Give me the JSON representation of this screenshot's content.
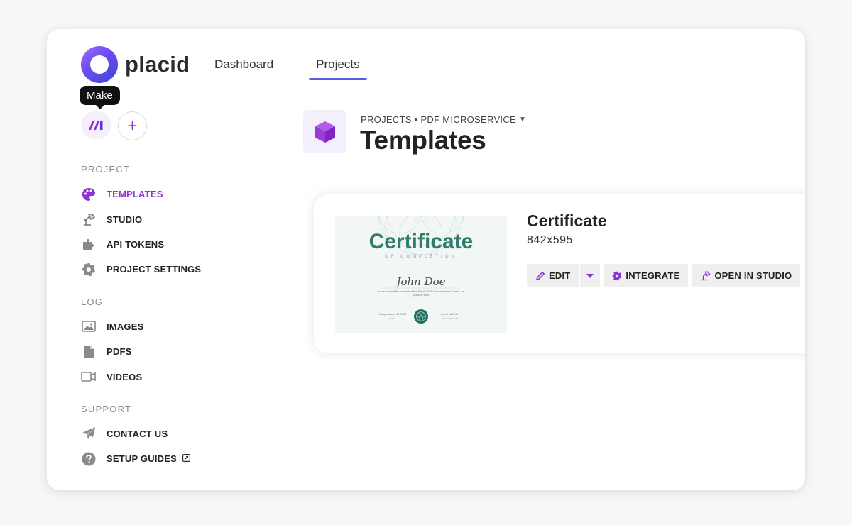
{
  "app": {
    "name": "placid"
  },
  "topnav": {
    "tabs": [
      {
        "label": "Dashboard",
        "active": false
      },
      {
        "label": "Projects",
        "active": true
      }
    ]
  },
  "workspace": {
    "tooltip": "Make",
    "add_label": "+"
  },
  "sidebar": {
    "sections": [
      {
        "title": "PROJECT",
        "items": [
          {
            "label": "TEMPLATES",
            "icon": "palette-icon",
            "active": true
          },
          {
            "label": "STUDIO",
            "icon": "lamp-icon",
            "active": false
          },
          {
            "label": "API TOKENS",
            "icon": "puzzle-icon",
            "active": false
          },
          {
            "label": "PROJECT SETTINGS",
            "icon": "gear-icon",
            "active": false
          }
        ]
      },
      {
        "title": "LOG",
        "items": [
          {
            "label": "IMAGES",
            "icon": "image-icon"
          },
          {
            "label": "PDFS",
            "icon": "file-icon"
          },
          {
            "label": "VIDEOS",
            "icon": "video-icon"
          }
        ]
      },
      {
        "title": "SUPPORT",
        "items": [
          {
            "label": "CONTACT US",
            "icon": "paper-plane-icon"
          },
          {
            "label": "SETUP GUIDES",
            "icon": "question-circle-icon",
            "external": true
          }
        ]
      }
    ]
  },
  "header": {
    "breadcrumb": "PROJECTS • PDF MICROSERVICE",
    "title": "Templates"
  },
  "template_card": {
    "name": "Certificate",
    "size": "842x595",
    "actions": {
      "edit": "EDIT",
      "integrate": "INTEGRATE",
      "open_in_studio": "OPEN IN STUDIO"
    },
    "preview": {
      "title": "Certificate",
      "subtitle": "OF COMPLETION",
      "recipient": "John Doe",
      "body": "You successfully completed the Placid PDF Microservice Course – at youtube.com",
      "date": "Friday, August 19 2022",
      "date_caption": "DATE",
      "signer": "armin ULRICH",
      "signer_caption": "PRESENTED BY"
    }
  },
  "colors": {
    "accent": "#8d33d6",
    "nav_underline": "#5b5ce6",
    "certificate_green": "#2f7d6d"
  }
}
